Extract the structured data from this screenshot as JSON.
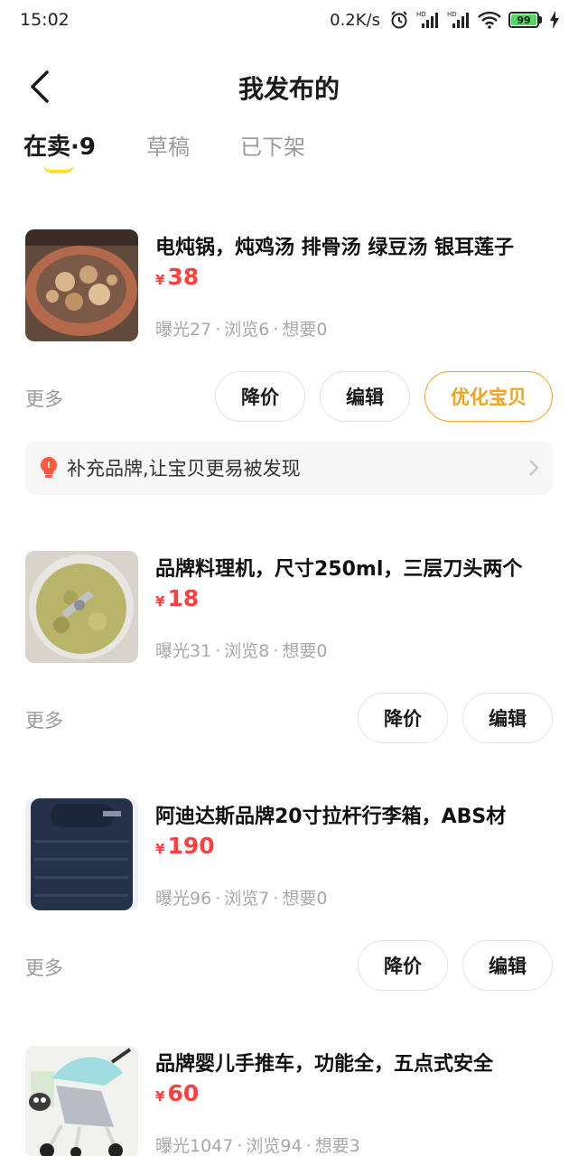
{
  "status_bar": {
    "time": "15:02",
    "net_speed": "0.2K/s",
    "battery_level": "99",
    "icons": [
      "alarm-icon",
      "signal-hd-icon",
      "signal-hd-icon",
      "wifi-icon",
      "battery-icon",
      "charging-icon"
    ]
  },
  "header": {
    "title": "我发布的"
  },
  "tabs": [
    {
      "label": "在卖·9",
      "active": true
    },
    {
      "label": "草稿",
      "active": false
    },
    {
      "label": "已下架",
      "active": false
    }
  ],
  "items": [
    {
      "title": "电炖锅，炖鸡汤 排骨汤 绿豆汤 银耳莲子",
      "currency": "¥",
      "price": "38",
      "stats": [
        "曝光27",
        "浏览6",
        "想要0"
      ],
      "more_label": "更多",
      "buttons": [
        "降价",
        "编辑",
        "优化宝贝"
      ],
      "tip": "补充品牌,让宝贝更易被发现",
      "thumb": "slow-cooker-photo"
    },
    {
      "title": "品牌料理机，尺寸250ml，三层刀头两个",
      "currency": "¥",
      "price": "18",
      "stats": [
        "曝光31",
        "浏览8",
        "想要0"
      ],
      "more_label": "更多",
      "buttons": [
        "降价",
        "编辑"
      ],
      "thumb": "food-processor-photo"
    },
    {
      "title": "阿迪达斯品牌20寸拉杆行李箱，ABS材",
      "currency": "¥",
      "price": "190",
      "stats": [
        "曝光96",
        "浏览7",
        "想要0"
      ],
      "more_label": "更多",
      "buttons": [
        "降价",
        "编辑"
      ],
      "thumb": "suitcase-photo"
    },
    {
      "title": "品牌婴儿手推车，功能全，五点式安全",
      "currency": "¥",
      "price": "60",
      "stats": [
        "曝光1047",
        "浏览94",
        "想要3"
      ],
      "thumb": "stroller-photo"
    }
  ],
  "colors": {
    "accent_yellow": "#ffe02a",
    "price_red": "#ff3e3e",
    "optimize_orange": "#f2a31a"
  }
}
